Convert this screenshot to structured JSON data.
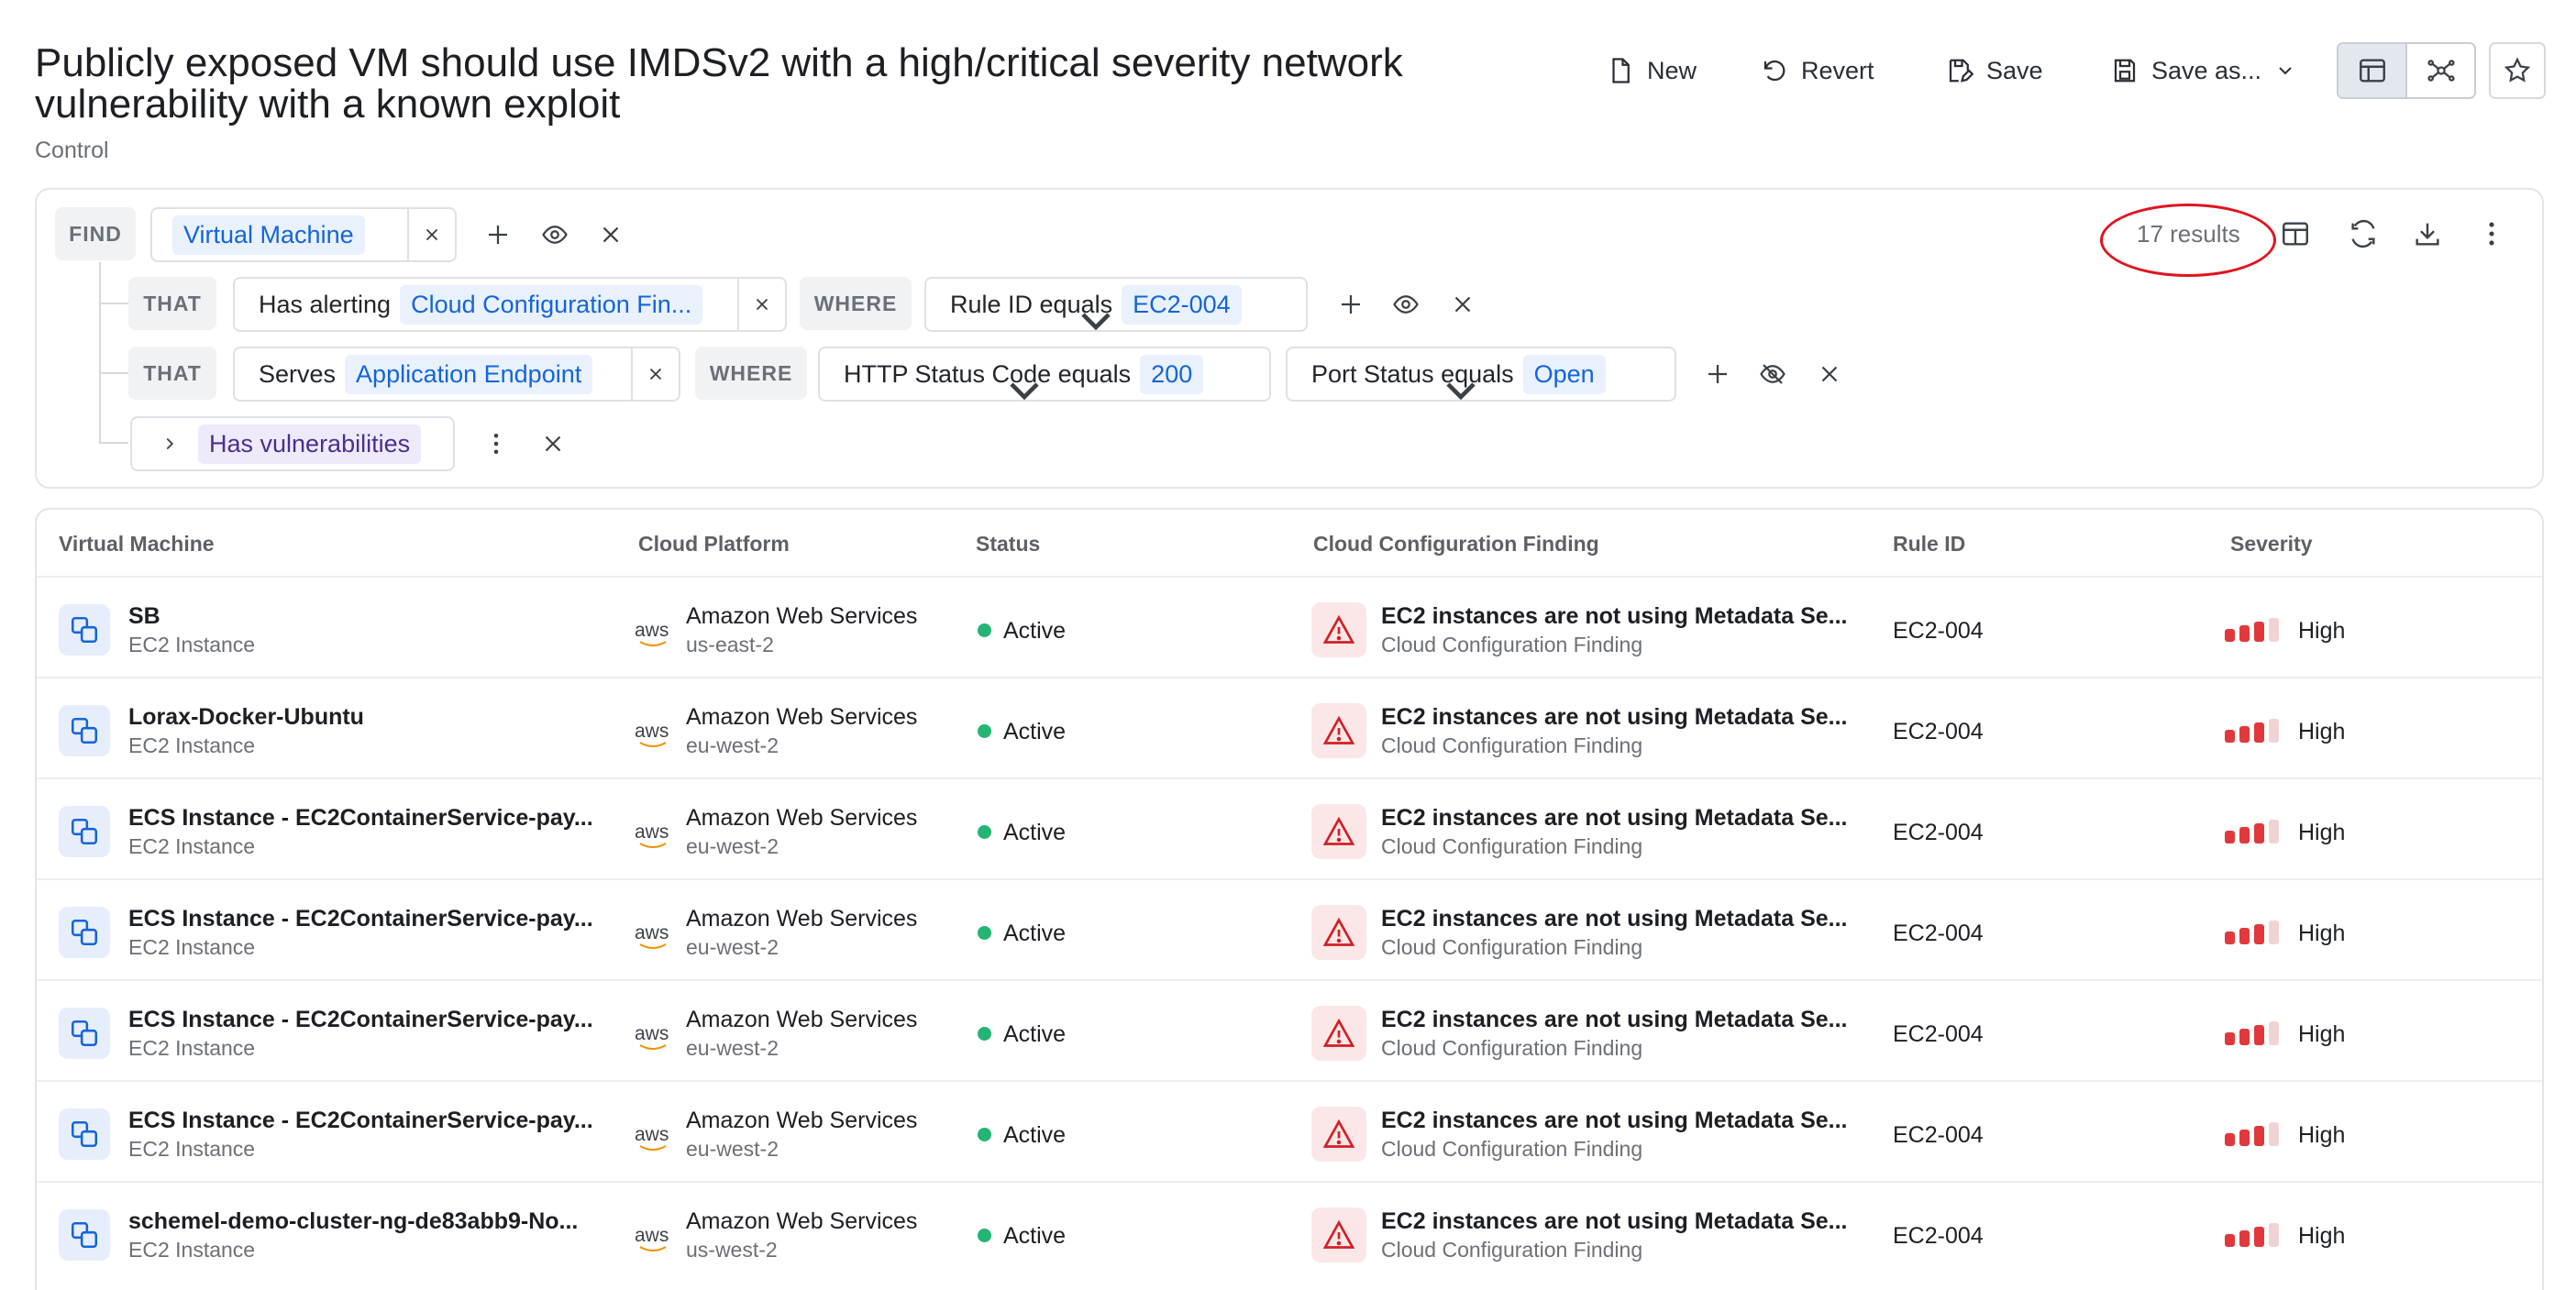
{
  "header": {
    "title": "Publicly exposed VM should use IMDSv2 with a high/critical severity network vulnerability with a known exploit",
    "subtitle": "Control",
    "buttons": {
      "new": "New",
      "revert": "Revert",
      "save": "Save",
      "save_as": "Save as..."
    },
    "icons": [
      "file-icon",
      "undo-icon",
      "save-edit-icon",
      "floppy-icon",
      "chevron-down-icon",
      "table-view-icon",
      "graph-view-icon",
      "star-icon"
    ]
  },
  "query": {
    "find_kw": "FIND",
    "that_kw": "THAT",
    "where_kw": "WHERE",
    "find_entity": "Virtual Machine",
    "row1": {
      "relation": "Has alerting",
      "entity": "Cloud Configuration Fin...",
      "condition_label": "Rule ID equals",
      "condition_value": "EC2-004"
    },
    "row2": {
      "relation": "Serves",
      "entity": "Application Endpoint",
      "cond1_label": "HTTP Status Code equals",
      "cond1_value": "200",
      "cond2_label": "Port Status equals",
      "cond2_value": "Open"
    },
    "row3": {
      "group": "Has vulnerabilities"
    },
    "results": "17 results"
  },
  "table": {
    "columns": [
      "Virtual Machine",
      "Cloud Platform",
      "Status",
      "Cloud Configuration Finding",
      "Rule ID",
      "Severity"
    ],
    "rows": [
      {
        "name": "SB",
        "type": "EC2 Instance",
        "platform": "Amazon Web Services",
        "region": "us-east-2",
        "status": "Active",
        "finding": "EC2 instances are not using Metadata Se...",
        "finding_type": "Cloud Configuration Finding",
        "rule": "EC2-004",
        "severity": "High"
      },
      {
        "name": "Lorax-Docker-Ubuntu",
        "type": "EC2 Instance",
        "platform": "Amazon Web Services",
        "region": "eu-west-2",
        "status": "Active",
        "finding": "EC2 instances are not using Metadata Se...",
        "finding_type": "Cloud Configuration Finding",
        "rule": "EC2-004",
        "severity": "High"
      },
      {
        "name": "ECS Instance - EC2ContainerService-pay...",
        "type": "EC2 Instance",
        "platform": "Amazon Web Services",
        "region": "eu-west-2",
        "status": "Active",
        "finding": "EC2 instances are not using Metadata Se...",
        "finding_type": "Cloud Configuration Finding",
        "rule": "EC2-004",
        "severity": "High"
      },
      {
        "name": "ECS Instance - EC2ContainerService-pay...",
        "type": "EC2 Instance",
        "platform": "Amazon Web Services",
        "region": "eu-west-2",
        "status": "Active",
        "finding": "EC2 instances are not using Metadata Se...",
        "finding_type": "Cloud Configuration Finding",
        "rule": "EC2-004",
        "severity": "High"
      },
      {
        "name": "ECS Instance - EC2ContainerService-pay...",
        "type": "EC2 Instance",
        "platform": "Amazon Web Services",
        "region": "eu-west-2",
        "status": "Active",
        "finding": "EC2 instances are not using Metadata Se...",
        "finding_type": "Cloud Configuration Finding",
        "rule": "EC2-004",
        "severity": "High"
      },
      {
        "name": "ECS Instance - EC2ContainerService-pay...",
        "type": "EC2 Instance",
        "platform": "Amazon Web Services",
        "region": "eu-west-2",
        "status": "Active",
        "finding": "EC2 instances are not using Metadata Se...",
        "finding_type": "Cloud Configuration Finding",
        "rule": "EC2-004",
        "severity": "High"
      },
      {
        "name": "schemel-demo-cluster-ng-de83abb9-No...",
        "type": "EC2 Instance",
        "platform": "Amazon Web Services",
        "region": "us-west-2",
        "status": "Active",
        "finding": "EC2 instances are not using Metadata Se...",
        "finding_type": "Cloud Configuration Finding",
        "rule": "EC2-004",
        "severity": "High"
      }
    ],
    "aws_logo_text": "aws",
    "severity_level": 3,
    "severity_max": 4
  },
  "colors": {
    "accent_blue": "#1565d8",
    "status_active": "#22b573",
    "severity_high": "#e0383b",
    "annotation_red": "#e0141e"
  }
}
